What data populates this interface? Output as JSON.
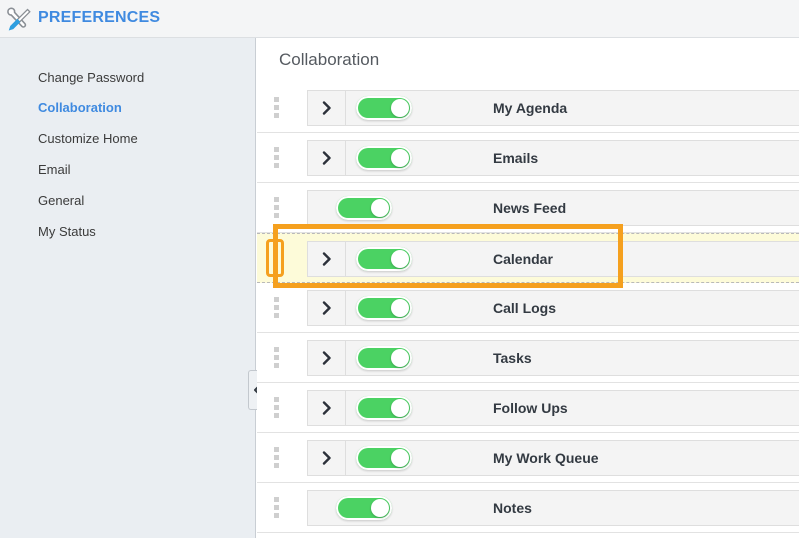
{
  "header": {
    "title": "PREFERENCES",
    "icon": "tools-icon"
  },
  "sidebar": {
    "items": [
      {
        "label": "Change Password",
        "active": false
      },
      {
        "label": "Collaboration",
        "active": true
      },
      {
        "label": "Customize Home",
        "active": false
      },
      {
        "label": "Email",
        "active": false
      },
      {
        "label": "General",
        "active": false
      },
      {
        "label": "My Status",
        "active": false
      }
    ],
    "collapse_handle_icon": "chevron-left-icon"
  },
  "main": {
    "section_title": "Collaboration",
    "rows": [
      {
        "label": "My Agenda",
        "toggle": "on",
        "has_chevron": true,
        "highlighted": false
      },
      {
        "label": "Emails",
        "toggle": "on",
        "has_chevron": true,
        "highlighted": false
      },
      {
        "label": "News Feed",
        "toggle": "on",
        "has_chevron": false,
        "highlighted": false
      },
      {
        "label": "Calendar",
        "toggle": "on",
        "has_chevron": true,
        "highlighted": true
      },
      {
        "label": "Call Logs",
        "toggle": "on",
        "has_chevron": true,
        "highlighted": false
      },
      {
        "label": "Tasks",
        "toggle": "on",
        "has_chevron": true,
        "highlighted": false
      },
      {
        "label": "Follow Ups",
        "toggle": "on",
        "has_chevron": true,
        "highlighted": false
      },
      {
        "label": "My Work Queue",
        "toggle": "on",
        "has_chevron": true,
        "highlighted": false
      },
      {
        "label": "Notes",
        "toggle": "on",
        "has_chevron": false,
        "highlighted": false
      }
    ]
  },
  "colors": {
    "accent_blue": "#3f8ae0",
    "toggle_on_green": "#4bd263",
    "highlight_orange": "#f5a01e",
    "highlight_row_yellow": "#fdfbd9",
    "sidebar_bg": "#eaeef2"
  }
}
